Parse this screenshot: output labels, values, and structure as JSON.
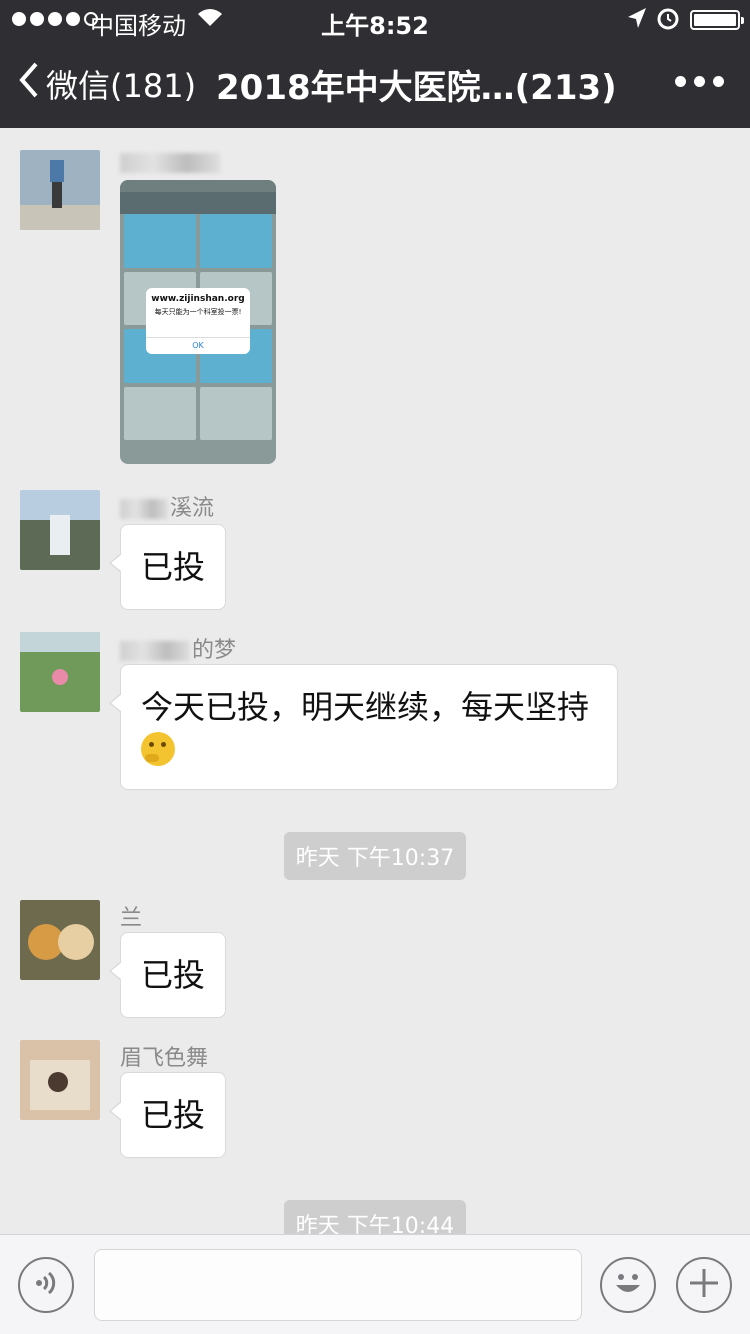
{
  "status_bar": {
    "carrier": "中国移动",
    "time": "上午8:52",
    "signal_bars": 4,
    "signal_total": 5,
    "battery_level": 1.0
  },
  "nav": {
    "back_label": "微信(181)",
    "title": "2018年中大医院…(213)",
    "more_icon": "more-dots-icon"
  },
  "messages": [
    {
      "sender": "",
      "type": "image",
      "image_texts": {
        "site": "www.zijinshan.org",
        "note": "每天只能为一个科室投一票!",
        "ok": "OK"
      }
    },
    {
      "sender_suffix": "溪流",
      "text": "已投"
    },
    {
      "sender_suffix": "的梦",
      "text": "今天已投，明天继续，每天坚持"
    }
  ],
  "timestamp_1": "昨天 下午10:37",
  "messages_2": [
    {
      "sender_suffix": "兰",
      "text": "已投"
    },
    {
      "sender": "眉飞色舞",
      "text": "已投"
    }
  ],
  "timestamp_2": "昨天 下午10:44",
  "input": {
    "value": "",
    "placeholder": ""
  }
}
